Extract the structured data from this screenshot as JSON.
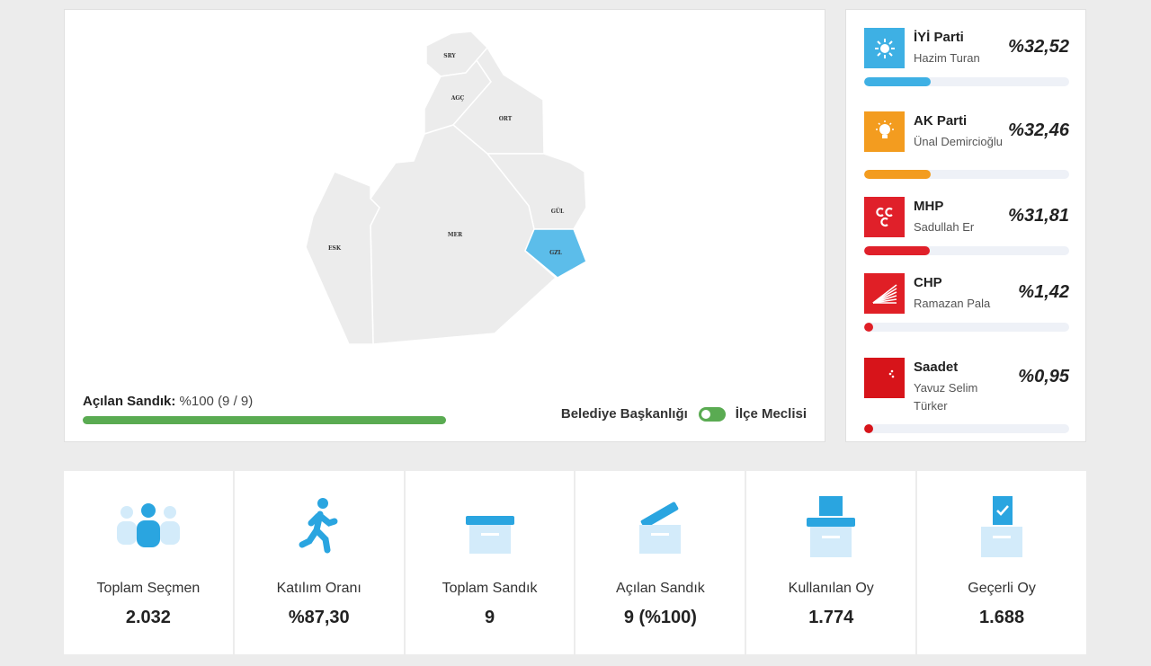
{
  "map": {
    "districts": [
      {
        "code": "SRY",
        "active": false
      },
      {
        "code": "AGÇ",
        "active": false
      },
      {
        "code": "ORT",
        "active": false
      },
      {
        "code": "GÜL",
        "active": false
      },
      {
        "code": "MER",
        "active": false
      },
      {
        "code": "ESK",
        "active": false
      },
      {
        "code": "GZL",
        "active": true
      }
    ],
    "opened_label": "Açılan Sandık:",
    "opened_value": "%100 (9 / 9)",
    "opened_fraction": 1.0,
    "toggle_left": "Belediye Başkanlığı",
    "toggle_right": "İlçe Meclisi",
    "toggle_on": true,
    "accent_active": "#5cbdea"
  },
  "results": [
    {
      "party": "İYİ Parti",
      "candidate": "Hazim Turan",
      "percent": "%32,52",
      "share": 0.3252,
      "color": "#3eb0e4",
      "icon": "sun-icon"
    },
    {
      "party": "AK Parti",
      "candidate": "Ünal Demircioğlu",
      "percent": "%32,46",
      "share": 0.3246,
      "color": "#f39c1f",
      "icon": "lightbulb-icon"
    },
    {
      "party": "MHP",
      "candidate": "Sadullah Er",
      "percent": "%31,81",
      "share": 0.3181,
      "color": "#e0202a",
      "icon": "three-crescents-icon"
    },
    {
      "party": "CHP",
      "candidate": "Ramazan Pala",
      "percent": "%1,42",
      "share": 0.0142,
      "color": "#e01f26",
      "icon": "six-arrows-icon"
    },
    {
      "party": "Saadet",
      "candidate": "Yavuz Selim Türker",
      "percent": "%0,95",
      "share": 0.0095,
      "color": "#d7141a",
      "icon": "crescent-stars-icon"
    }
  ],
  "stats": [
    {
      "label": "Toplam Seçmen",
      "value": "2.032",
      "icon": "people-icon"
    },
    {
      "label": "Katılım Oranı",
      "value": "%87,30",
      "icon": "walking-person-icon"
    },
    {
      "label": "Toplam Sandık",
      "value": "9",
      "icon": "ballot-box-icon"
    },
    {
      "label": "Açılan Sandık",
      "value": "9 (%100)",
      "icon": "opened-box-icon"
    },
    {
      "label": "Kullanılan Oy",
      "value": "1.774",
      "icon": "vote-box-icon"
    },
    {
      "label": "Geçerli Oy",
      "value": "1.688",
      "icon": "valid-vote-icon"
    }
  ]
}
